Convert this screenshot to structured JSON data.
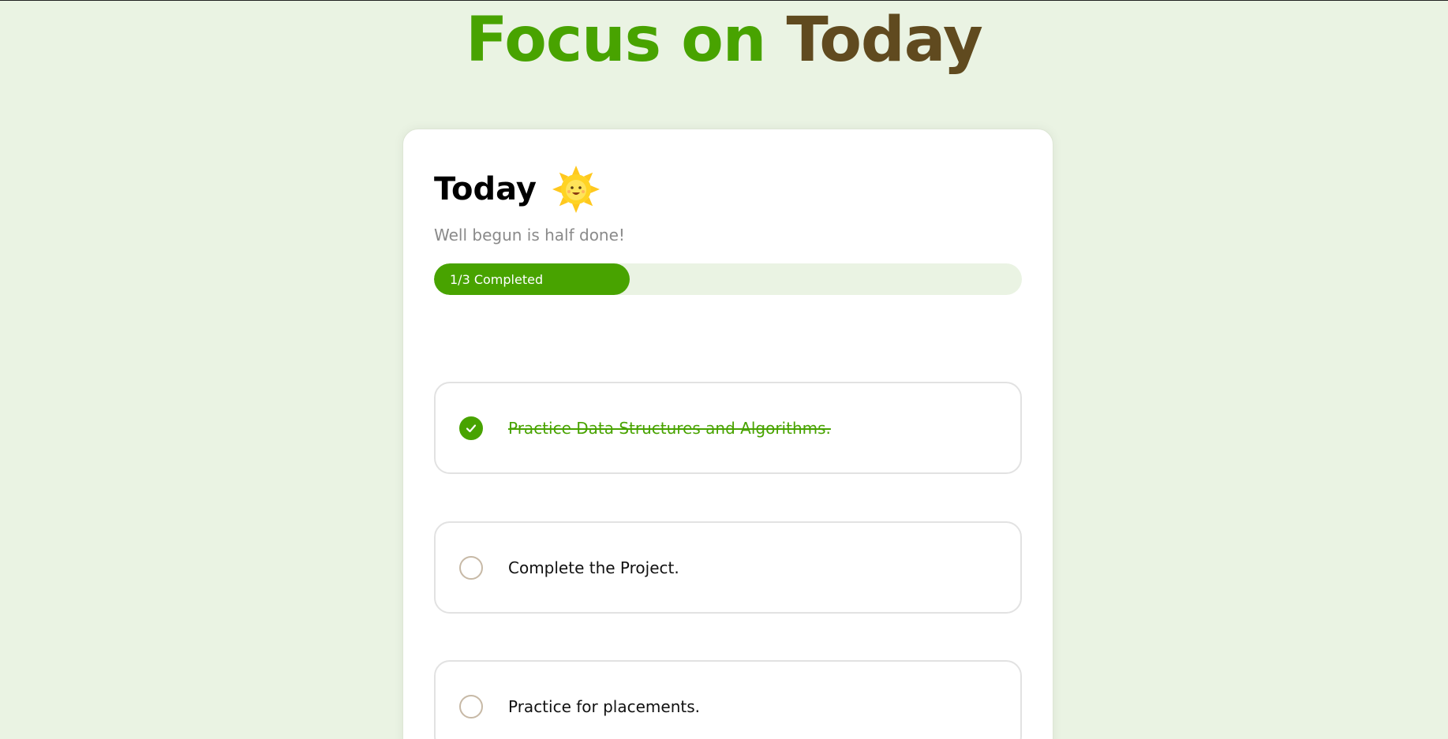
{
  "header": {
    "title_part1": "Focus on",
    "title_part2": "Today",
    "colors": {
      "accent_green": "#48A300",
      "accent_brown": "#604A1F",
      "background": "#EAF3E3"
    }
  },
  "card": {
    "heading": "Today",
    "heading_icon": "sun-icon",
    "subtitle": "Well begun is half done!",
    "progress": {
      "label": "1/3 Completed",
      "completed": 1,
      "total": 3
    }
  },
  "tasks": [
    {
      "text": "Practice Data Structures and Algorithms.",
      "completed": true,
      "icon": "check-icon"
    },
    {
      "text": "Complete the Project.",
      "completed": false
    },
    {
      "text": "Practice for placements.",
      "completed": false
    }
  ]
}
